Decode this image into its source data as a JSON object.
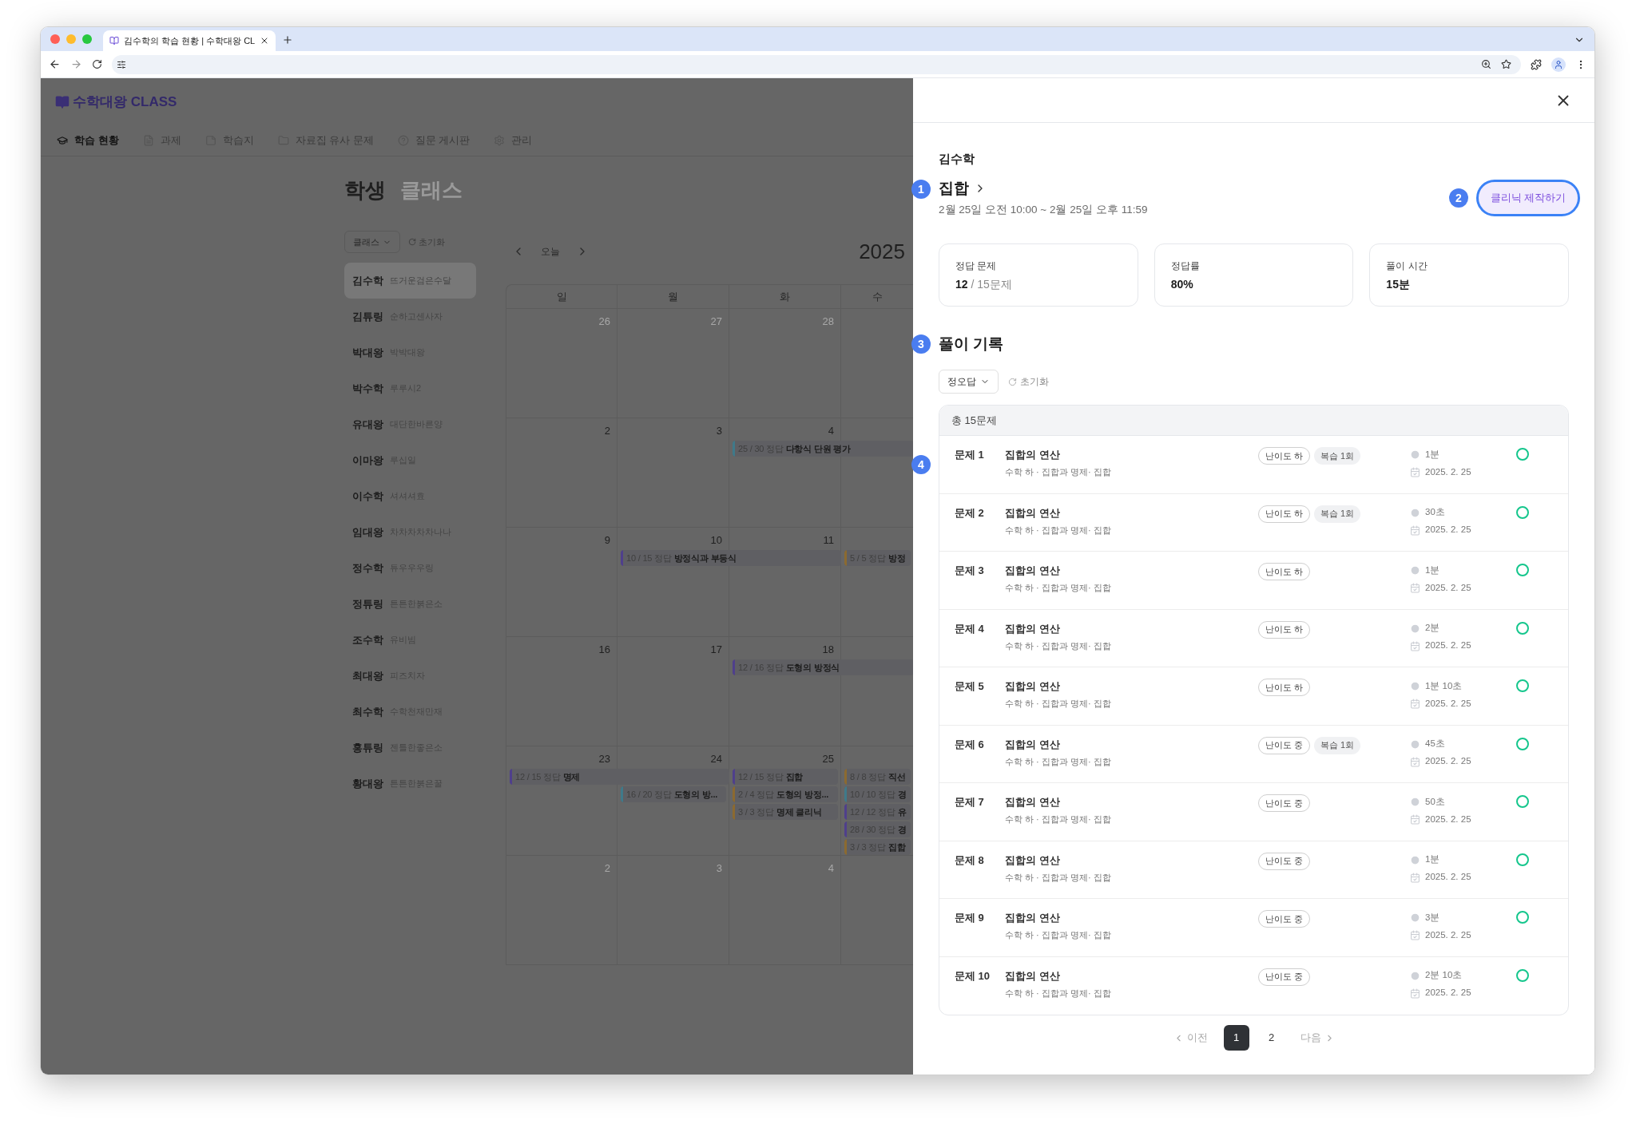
{
  "browser": {
    "tab_title": "김수학의 학습 현황 | 수학대왕 CL"
  },
  "app": {
    "logo": "수학대왕 CLASS",
    "nav": [
      {
        "label": "학습 현황",
        "selected": true
      },
      {
        "label": "과제",
        "selected": false
      },
      {
        "label": "학습지",
        "selected": false
      },
      {
        "label": "자료집 유사 문제",
        "selected": false
      },
      {
        "label": "질문 게시판",
        "selected": false
      },
      {
        "label": "관리",
        "selected": false
      }
    ],
    "page_tabs": [
      {
        "label": "학생",
        "selected": true
      },
      {
        "label": "클래스",
        "selected": false
      }
    ],
    "filter": "클래스",
    "reset": "초기화",
    "students": [
      {
        "name": "김수학",
        "nick": "뜨거운검은수달",
        "selected": true
      },
      {
        "name": "김튜링",
        "nick": "순하고센사자",
        "selected": false
      },
      {
        "name": "박대왕",
        "nick": "박박대왕",
        "selected": false
      },
      {
        "name": "박수학",
        "nick": "루루시2",
        "selected": false
      },
      {
        "name": "유대왕",
        "nick": "대단한바른양",
        "selected": false
      },
      {
        "name": "이마왕",
        "nick": "루십일",
        "selected": false
      },
      {
        "name": "이수학",
        "nick": "셔셔셔효",
        "selected": false
      },
      {
        "name": "임대왕",
        "nick": "차차차차차나나",
        "selected": false
      },
      {
        "name": "정수학",
        "nick": "튜우우우링",
        "selected": false
      },
      {
        "name": "정튜링",
        "nick": "튼튼한붉은소",
        "selected": false
      },
      {
        "name": "조수학",
        "nick": "유비빔",
        "selected": false
      },
      {
        "name": "최대왕",
        "nick": "피즈치자",
        "selected": false
      },
      {
        "name": "최수학",
        "nick": "수학천재만재",
        "selected": false
      },
      {
        "name": "홍튜링",
        "nick": "젠틀한좋은소",
        "selected": false
      },
      {
        "name": "황대왕",
        "nick": "튼튼한붉은꿀",
        "selected": false
      }
    ],
    "calendar": {
      "today": "오늘",
      "title": "2025",
      "weekdays": [
        "일",
        "월",
        "화",
        "수"
      ],
      "weeks": [
        {
          "days": [
            {
              "label": "26",
              "outside": true
            },
            {
              "label": "27",
              "outside": true
            },
            {
              "label": "28",
              "outside": true
            }
          ]
        },
        {
          "days": [
            {
              "label": "2",
              "outside": false
            },
            {
              "label": "3",
              "outside": false
            },
            {
              "label": "4",
              "outside": false,
              "events": [
                {
                  "score": "25 / 30 정답",
                  "title": "다항식 단원 평가",
                  "color": "#3f7a8a",
                  "continues": true
                }
              ]
            }
          ]
        },
        {
          "days": [
            {
              "label": "9",
              "outside": false
            },
            {
              "label": "10",
              "outside": false,
              "events": [
                {
                  "score": "10 / 15 정답",
                  "title": "방정식과 부등식",
                  "color": "#4f3f8c",
                  "continues": true
                }
              ]
            },
            {
              "label": "11",
              "outside": false
            },
            {
              "events": [
                {
                  "score": "5 / 5 정답",
                  "title": "방정",
                  "color": "#8c6a30",
                  "continues": false
                }
              ]
            }
          ]
        },
        {
          "days": [
            {
              "label": "16",
              "outside": false
            },
            {
              "label": "17",
              "outside": false
            },
            {
              "label": "18",
              "outside": false,
              "events": [
                {
                  "score": "12 / 16 정답",
                  "title": "도형의 방정식",
                  "color": "#4f3f8c",
                  "continues": true
                }
              ]
            }
          ]
        },
        {
          "days": [
            {
              "label": "23",
              "outside": false,
              "events": [
                {
                  "score": "12 / 15 정답",
                  "title": "명제",
                  "color": "#4f3f8c",
                  "continues": true
                }
              ]
            },
            {
              "label": "24",
              "outside": false,
              "events": [
                {
                  "score": "16 / 20 정답",
                  "title": "도형의 방...",
                  "color": "#3f7a8a",
                  "continues": false
                }
              ]
            },
            {
              "label": "25",
              "outside": false,
              "events": [
                {
                  "score": "12 / 15 정답",
                  "title": "집합",
                  "color": "#4f3f8c",
                  "continues": false
                },
                {
                  "score": "2 / 4 정답",
                  "title": "도형의 방정...",
                  "color": "#8c6a30",
                  "continues": false
                },
                {
                  "score": "3 / 3 정답",
                  "title": "명제 클리닉",
                  "color": "#8c6a30",
                  "continues": false
                }
              ]
            },
            {
              "events": [
                {
                  "score": "8 / 8 정답",
                  "title": "직선",
                  "color": "#8c6a30",
                  "continues": false
                },
                {
                  "score": "10 / 10 정답",
                  "title": "경",
                  "color": "#3f7a8a",
                  "continues": false
                },
                {
                  "score": "12 / 12 정답",
                  "title": "유",
                  "color": "#4f3f8c",
                  "continues": false
                },
                {
                  "score": "28 / 30 정답",
                  "title": "경",
                  "color": "#4f3f8c",
                  "continues": false
                },
                {
                  "score": "3 / 3 정답",
                  "title": "집합",
                  "color": "#8c6a30",
                  "continues": false
                }
              ]
            }
          ]
        },
        {
          "days": [
            {
              "label": "2",
              "outside": true
            },
            {
              "label": "3",
              "outside": true
            },
            {
              "label": "4",
              "outside": true
            }
          ]
        }
      ]
    }
  },
  "panel": {
    "student": "김수학",
    "title": "집합",
    "period": "2월 25일 오전 10:00 ~ 2월 25일 오후 11:59",
    "clinic_button": "클리닉 제작하기",
    "markers": [
      "1",
      "2",
      "3",
      "4"
    ],
    "stats": [
      {
        "label": "정답 문제",
        "value": "12",
        "suffix": "/ 15문제"
      },
      {
        "label": "정답률",
        "value": "80%"
      },
      {
        "label": "풀이 시간",
        "value": "15분"
      }
    ],
    "history_title": "풀이 기록",
    "filter": "정오답",
    "reset": "초기화",
    "total": "총 15문제",
    "problems": [
      {
        "number": "문제 1",
        "title": "집합의 연산",
        "path": "수학 하 · 집합과 명제· 집합",
        "tags": [
          {
            "kind": "difficulty",
            "label": "난이도 하"
          },
          {
            "kind": "review",
            "label": "복습 1회"
          }
        ],
        "time": "1분",
        "date": "2025. 2. 25",
        "correct": true
      },
      {
        "number": "문제 2",
        "title": "집합의 연산",
        "path": "수학 하 · 집합과 명제· 집합",
        "tags": [
          {
            "kind": "difficulty",
            "label": "난이도 하"
          },
          {
            "kind": "review",
            "label": "복습 1회"
          }
        ],
        "time": "30초",
        "date": "2025. 2. 25",
        "correct": true
      },
      {
        "number": "문제 3",
        "title": "집합의 연산",
        "path": "수학 하 · 집합과 명제· 집합",
        "tags": [
          {
            "kind": "difficulty",
            "label": "난이도 하"
          }
        ],
        "time": "1분",
        "date": "2025. 2. 25",
        "correct": true
      },
      {
        "number": "문제 4",
        "title": "집합의 연산",
        "path": "수학 하 · 집합과 명제· 집합",
        "tags": [
          {
            "kind": "difficulty",
            "label": "난이도 하"
          }
        ],
        "time": "2분",
        "date": "2025. 2. 25",
        "correct": true
      },
      {
        "number": "문제 5",
        "title": "집합의 연산",
        "path": "수학 하 · 집합과 명제· 집합",
        "tags": [
          {
            "kind": "difficulty",
            "label": "난이도 하"
          }
        ],
        "time": "1분 10초",
        "date": "2025. 2. 25",
        "correct": true
      },
      {
        "number": "문제 6",
        "title": "집합의 연산",
        "path": "수학 하 · 집합과 명제· 집합",
        "tags": [
          {
            "kind": "difficulty",
            "label": "난이도 중"
          },
          {
            "kind": "review",
            "label": "복습 1회"
          }
        ],
        "time": "45초",
        "date": "2025. 2. 25",
        "correct": true
      },
      {
        "number": "문제 7",
        "title": "집합의 연산",
        "path": "수학 하 · 집합과 명제· 집합",
        "tags": [
          {
            "kind": "difficulty",
            "label": "난이도 중"
          }
        ],
        "time": "50초",
        "date": "2025. 2. 25",
        "correct": true
      },
      {
        "number": "문제 8",
        "title": "집합의 연산",
        "path": "수학 하 · 집합과 명제· 집합",
        "tags": [
          {
            "kind": "difficulty",
            "label": "난이도 중"
          }
        ],
        "time": "1분",
        "date": "2025. 2. 25",
        "correct": true
      },
      {
        "number": "문제 9",
        "title": "집합의 연산",
        "path": "수학 하 · 집합과 명제· 집합",
        "tags": [
          {
            "kind": "difficulty",
            "label": "난이도 중"
          }
        ],
        "time": "3분",
        "date": "2025. 2. 25",
        "correct": true
      },
      {
        "number": "문제 10",
        "title": "집합의 연산",
        "path": "수학 하 · 집합과 명제· 집합",
        "tags": [
          {
            "kind": "difficulty",
            "label": "난이도 중"
          }
        ],
        "time": "2분 10초",
        "date": "2025. 2. 25",
        "correct": true
      }
    ],
    "pagination": {
      "prev": "이전",
      "next": "다음",
      "pages": [
        {
          "label": "1",
          "selected": true
        },
        {
          "label": "2",
          "selected": false
        }
      ]
    }
  }
}
